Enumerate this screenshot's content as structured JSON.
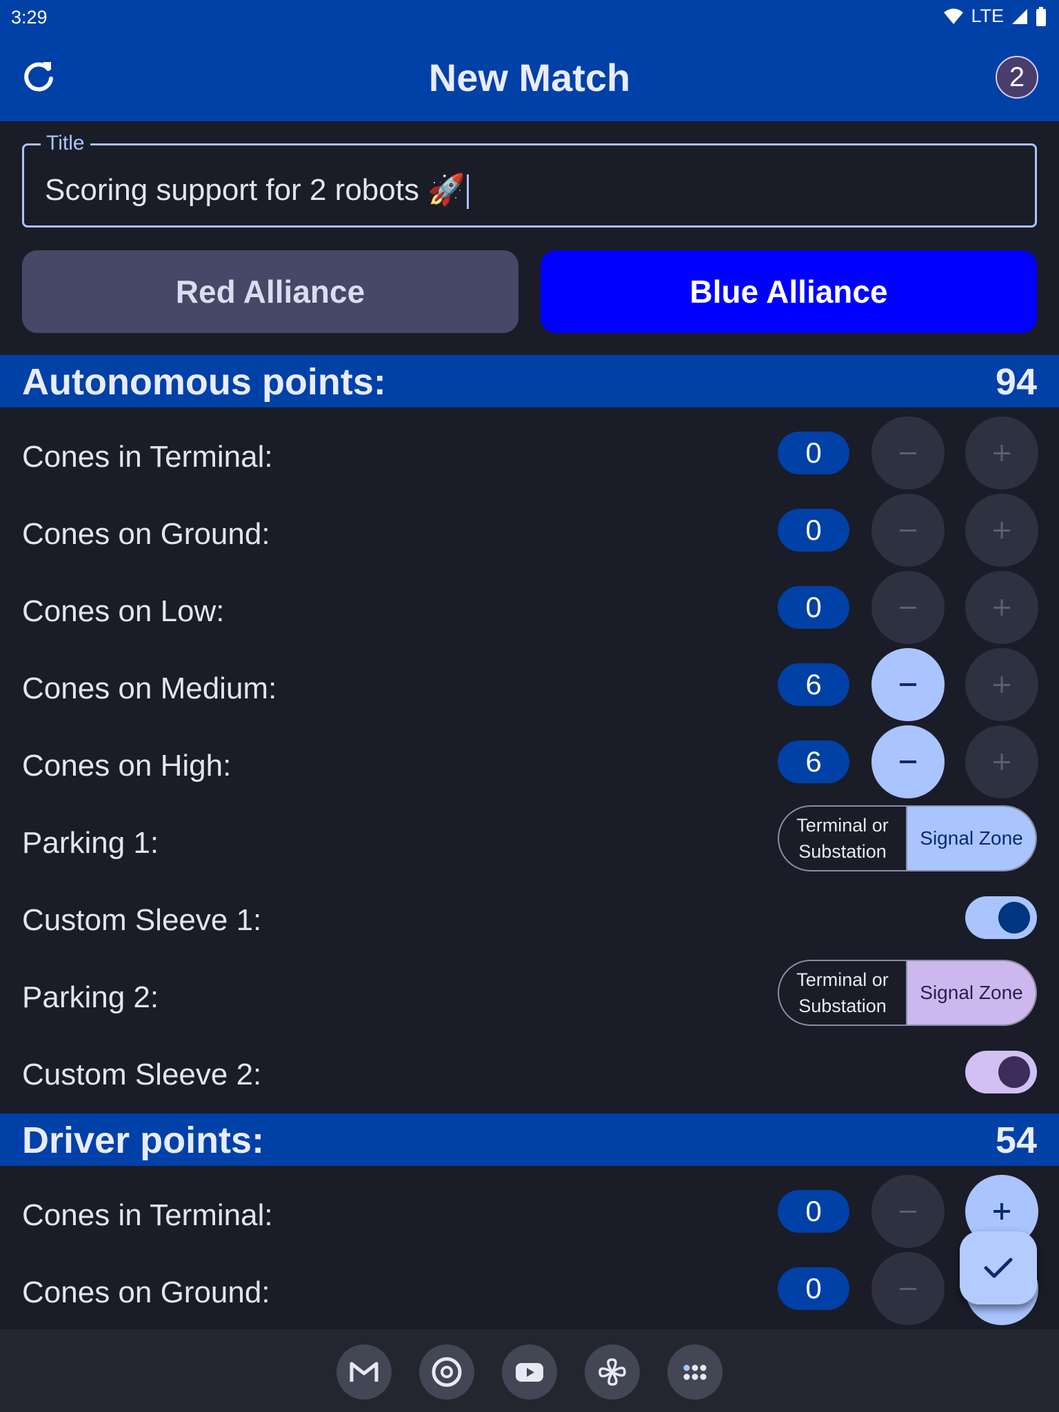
{
  "status_bar": {
    "time": "3:29",
    "network": "LTE",
    "icons": [
      "wifi-icon",
      "signal-icon",
      "battery-icon"
    ]
  },
  "app_bar": {
    "title": "New Match",
    "badge": "2",
    "refresh_icon": "refresh-icon"
  },
  "title_field": {
    "label": "Title",
    "value": "Scoring support for 2 robots 🚀"
  },
  "alliance": {
    "red_label": "Red Alliance",
    "blue_label": "Blue Alliance",
    "selected": "Blue Alliance"
  },
  "autonomous": {
    "header": "Autonomous points:",
    "points": "94",
    "rows": [
      {
        "label": "Cones in Terminal:",
        "value": "0"
      },
      {
        "label": "Cones on Ground:",
        "value": "0"
      },
      {
        "label": "Cones on Low:",
        "value": "0"
      },
      {
        "label": "Cones on Medium:",
        "value": "6"
      },
      {
        "label": "Cones on High:",
        "value": "6"
      }
    ],
    "parking1": {
      "label": "Parking 1:",
      "option1": "Terminal or Substation",
      "option2": "Signal Zone",
      "selected": "Signal Zone"
    },
    "sleeve1": {
      "label": "Custom Sleeve 1:",
      "on": true
    },
    "parking2": {
      "label": "Parking 2:",
      "option1": "Terminal or Substation",
      "option2": "Signal Zone",
      "selected": "Signal Zone"
    },
    "sleeve2": {
      "label": "Custom Sleeve 2:",
      "on": true
    }
  },
  "driver": {
    "header": "Driver points:",
    "points": "54",
    "rows": [
      {
        "label": "Cones in Terminal:",
        "value": "0"
      },
      {
        "label": "Cones on Ground:",
        "value": "0"
      }
    ]
  },
  "buttons": {
    "minus": "−",
    "plus": "+"
  },
  "dock": {
    "apps": [
      "gmail-icon",
      "chrome-icon",
      "youtube-icon",
      "pinwheel-icon",
      "app-drawer-icon"
    ]
  },
  "colors": {
    "primary": "#0041a8",
    "accent": "#aac4ff",
    "blue_alliance": "#0000ff",
    "background": "#1a1c28"
  }
}
